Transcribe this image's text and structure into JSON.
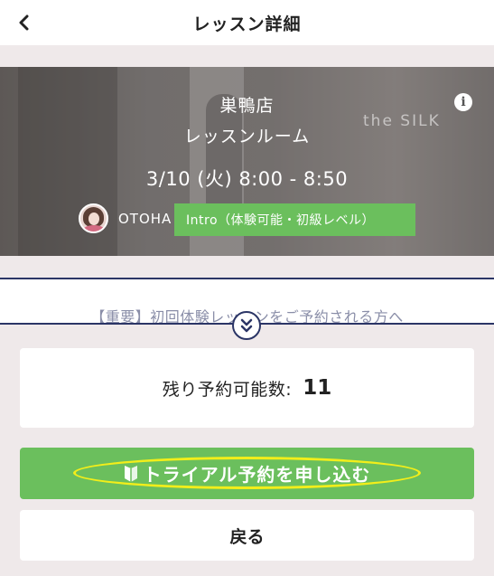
{
  "header": {
    "title": "レッスン詳細",
    "back_icon": "chevron-left-icon"
  },
  "hero": {
    "studio": "巣鴨店",
    "room": "レッスンルーム",
    "datetime": "3/10 (火) 8:00 - 8:50",
    "instructor": "OTOHA",
    "level": "Intro（体験可能・初級レベル）",
    "watermark": "the SILK",
    "info_icon": "info-icon"
  },
  "notice": {
    "text": "【重要】初回体験レッスンをご予約される方へ",
    "expand_icon": "double-chevron-down-icon"
  },
  "availability": {
    "label": "残り予約可能数:",
    "count": "11"
  },
  "actions": {
    "trial_label": "トライアル予約を申し込む",
    "back_label": "戻る"
  },
  "colors": {
    "accent_green": "#6bbf5d",
    "navy": "#2b3566",
    "background": "#efe9ea",
    "highlight_yellow": "#f2ee1a"
  }
}
